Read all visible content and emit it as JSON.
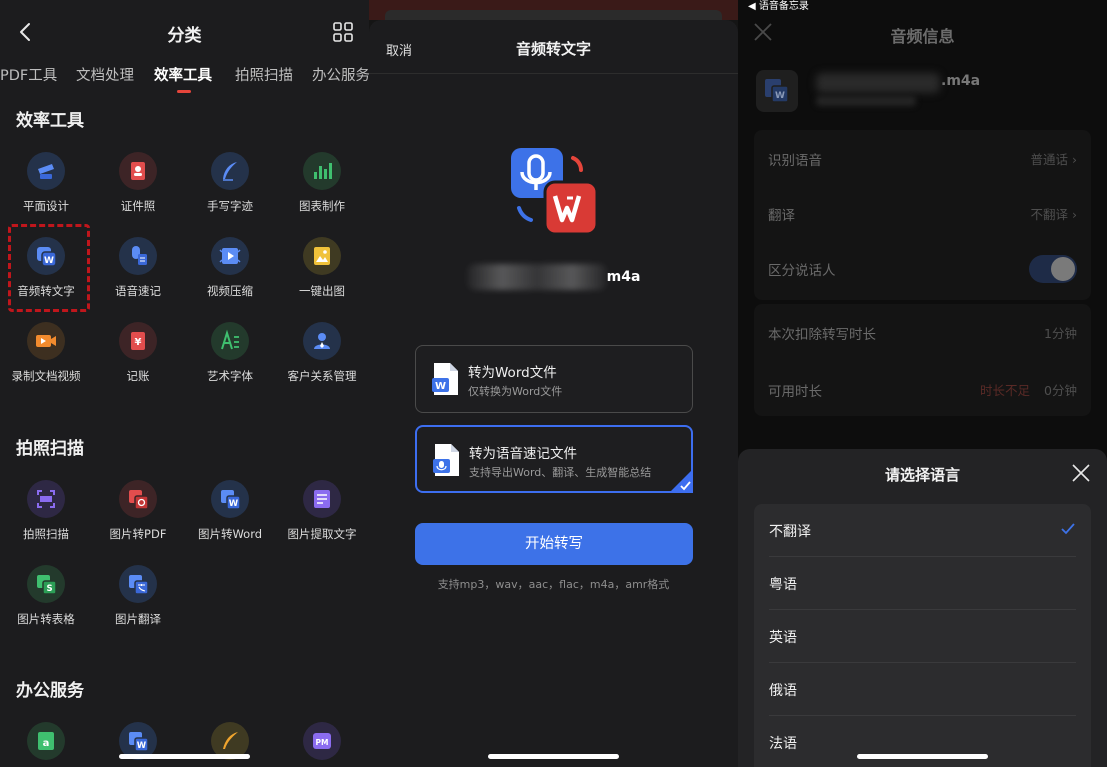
{
  "panel1": {
    "title": "分类",
    "tabs": [
      "PDF工具",
      "文档处理",
      "效率工具",
      "拍照扫描",
      "办公服务"
    ],
    "active_tab": "效率工具",
    "sections": {
      "efficiency": {
        "title": "效率工具",
        "tools": [
          "平面设计",
          "证件照",
          "手写字迹",
          "图表制作",
          "音频转文字",
          "语音速记",
          "视频压缩",
          "一键出图",
          "录制文档视频",
          "记账",
          "艺术字体",
          "客户关系管理"
        ]
      },
      "scan": {
        "title": "拍照扫描",
        "tools": [
          "拍照扫描",
          "图片转PDF",
          "图片转Word",
          "图片提取文字",
          "图片转表格",
          "图片翻译"
        ]
      },
      "office": {
        "title": "办公服务"
      }
    }
  },
  "panel2": {
    "top_bar_time": "",
    "cancel": "取消",
    "title": "音频转文字",
    "file_ext": "m4a",
    "options": [
      {
        "title": "转为Word文件",
        "desc": "仅转换为Word文件",
        "selected": false
      },
      {
        "title": "转为语音速记文件",
        "desc": "支持导出Word、翻译、生成智能总结",
        "selected": true
      }
    ],
    "start_button": "开始转写",
    "formats": "支持mp3，wav，aac，flac，m4a，amr格式"
  },
  "panel3": {
    "status_back": "◀ 语音备忘录",
    "title": "音频信息",
    "file_ext": ".m4a",
    "rows": {
      "recognize_label": "识别语音",
      "recognize_value": "普通话",
      "translate_label": "翻译",
      "translate_value": "不翻译",
      "speaker_label": "区分说话人",
      "deduct_label": "本次扣除转写时长",
      "deduct_value": "1分钟",
      "available_label": "可用时长",
      "available_warning": "时长不足",
      "available_value": "0分钟"
    },
    "lang_sheet": {
      "title": "请选择语言",
      "items": [
        "不翻译",
        "粤语",
        "英语",
        "俄语",
        "法语"
      ],
      "selected": "不翻译"
    }
  },
  "colors": {
    "accent_blue": "#3d72e8",
    "tab_underline": "#e5453b",
    "highlight_dashed": "#c0161c"
  }
}
